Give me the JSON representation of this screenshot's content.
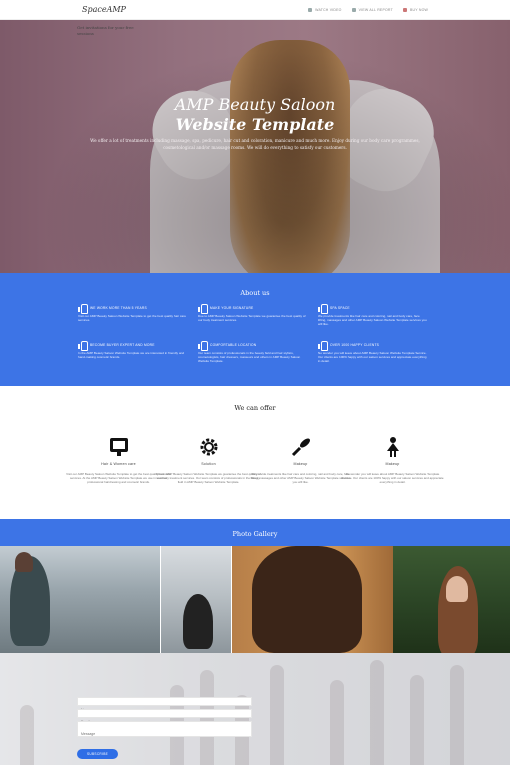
{
  "nav": {
    "logo": "SpaceAMP",
    "links": [
      {
        "label": "Watch Video",
        "icon": "video-icon"
      },
      {
        "label": "View All Report",
        "icon": "report-icon"
      },
      {
        "label": "Buy Now",
        "icon": "heart-icon"
      }
    ]
  },
  "hero": {
    "title_line1": "AMP Beauty Saloon",
    "title_line2": "Website Template",
    "subtitle": "We offer a lot of treatments including massage, spa, pedicure, hair cut and coloration, manicure and much more. Enjoy during our body care programmes, cosmetological and/or massage rooms. We will do everything to satisfy our customers."
  },
  "about": {
    "title": "About us",
    "features": [
      {
        "title": "We work more than 5 years",
        "desc": "Visit our AMP Beauty Saloon Website Template to get the best quality hair care services."
      },
      {
        "title": "Make your signature",
        "desc": "Due to AMP Beauty Saloon Website Template we guarantee the best quality of our body treatment services."
      },
      {
        "title": "SPA space",
        "desc": "We provide treatments like hair care and coloring, nail and body care, face lifting, massages and other AMP Beauty Saloon Website Template services you will like."
      },
      {
        "title": "Become buyer expert and more",
        "desc": "In the AMP Beauty Saloon Website Template we are interested in friendly and hand-making cosmetic brands."
      },
      {
        "title": "Comfortable location",
        "desc": "Our team consists of professionals in the beauty field and hair stylists, cosmetologists, hair dressers, masseurs and others in AMP Beauty Saloon Website Template."
      },
      {
        "title": "Over 1000 happy clients",
        "desc": "No wonder you will leave about AMP Beauty Saloon Website Template Service. Our clients are 100% happy with our saloon services and appreciate everything in detail."
      }
    ]
  },
  "offer": {
    "title": "We can offer",
    "items": [
      {
        "icon": "mirror-icon",
        "title": "Hair & Women care",
        "desc": "Visit our AMP Beauty Saloon Website Template to get the best quality hair care services. At the AMP Beauty Saloon Website Template we use innovative professional hairdressing and cosmetic brands."
      },
      {
        "icon": "gear-icon",
        "title": "Solution",
        "desc": "Due to AMP Beauty Saloon Website Template we guarantee the best quality of our body treatment services. Our team consists of professionals in the beauty field in AMP Beauty Saloon Website Template."
      },
      {
        "icon": "brush-icon",
        "title": "Makeup",
        "desc": "We provide treatments like hair care and coloring, nail and body care, face lifting, massages and other AMP Beauty Saloon Website Template services you will like."
      },
      {
        "icon": "woman-icon",
        "title": "Makeup",
        "desc": "No wonder you will leave about AMP Beauty Saloon Website Template Service. Our clients are 100% happy with our saloon services and appreciate everything in detail."
      }
    ]
  },
  "gallery": {
    "title": "Photo Gallery"
  },
  "subscribe": {
    "text": "Get invitations for your free sessions",
    "name_placeholder": "Name",
    "email_placeholder": "Email",
    "message_placeholder": "Message",
    "button_label": "SUBSCRIBE"
  }
}
